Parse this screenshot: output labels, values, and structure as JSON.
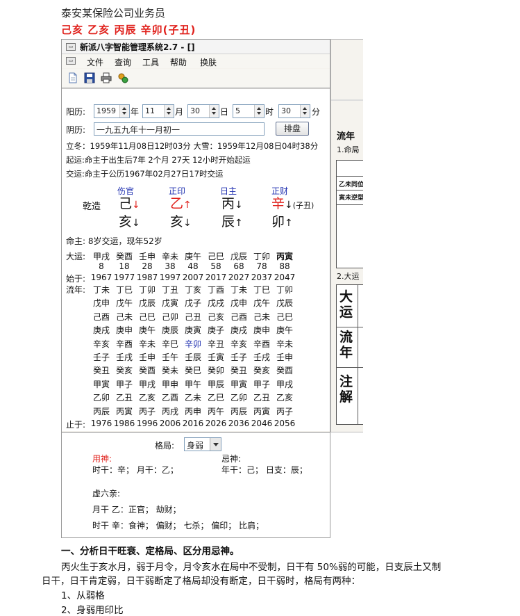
{
  "doc": {
    "title": "泰安某保险公司业务员",
    "bazi": "己亥 乙亥 丙辰 辛卯(子丑)"
  },
  "window": {
    "title": "新派八字智能管理系统2.7 - []",
    "menu": [
      "文件",
      "查询",
      "工具",
      "帮助",
      "换肤"
    ],
    "toolbar_icons": [
      "new-doc-icon",
      "save-icon",
      "print-icon",
      "settings-icon"
    ]
  },
  "form": {
    "solar_label": "阳历:",
    "year": "1959",
    "year_unit": "年",
    "month": "11",
    "month_unit": "月",
    "day": "30",
    "day_unit": "日",
    "hour": "5",
    "hour_unit": "时",
    "minute": "30",
    "minute_unit": "分",
    "lunar_label": "阴历:",
    "lunar_value": "一九五九年十一月初一",
    "arrange_button": "排盘",
    "jieqi": "立冬：1959年11月08日12时03分 大雪：1959年12月08日04时38分",
    "qiyun": "起运:命主于出生后7年 2个月 27天 12小时开始起运",
    "jiaoyun": "交运:命主于公历1967年02月27日17时交运"
  },
  "chart": {
    "qianzao": "乾造",
    "gods": [
      "伤官",
      "正印",
      "日主",
      "正财"
    ],
    "stems": [
      "己",
      "乙",
      "丙",
      "辛"
    ],
    "stem_arrows": [
      "↓",
      "↑",
      "↓",
      "↓"
    ],
    "branches": [
      "亥",
      "亥",
      "辰",
      "卯"
    ],
    "branch_arrows": [
      "↓",
      "↓",
      "↑",
      "↑"
    ],
    "kongwang": "(子丑)"
  },
  "dayun": {
    "mingzhu": "命主: 8岁交运，现年52岁",
    "label": "大运:",
    "pillars": [
      "甲戌",
      "癸酉",
      "壬申",
      "辛未",
      "庚午",
      "己巳",
      "戊辰",
      "丁卯",
      "丙寅"
    ],
    "ages": [
      "8",
      "18",
      "28",
      "38",
      "48",
      "58",
      "68",
      "78",
      "88"
    ],
    "start_label": "始于:",
    "start_years": [
      "1967",
      "1977",
      "1987",
      "1997",
      "2007",
      "2017",
      "2027",
      "2037",
      "2047"
    ],
    "liunian_label": "流年:",
    "liunian_rows": [
      [
        "丁未",
        "丁巳",
        "丁卯",
        "丁丑",
        "丁亥",
        "丁酉",
        "丁未",
        "丁巳",
        "丁卯"
      ],
      [
        "戊申",
        "戊午",
        "戊辰",
        "戊寅",
        "戊子",
        "戊戌",
        "戊申",
        "戊午",
        "戊辰"
      ],
      [
        "己酉",
        "己未",
        "己巳",
        "己卯",
        "己丑",
        "己亥",
        "己酉",
        "己未",
        "己巳"
      ],
      [
        "庚戌",
        "庚申",
        "庚午",
        "庚辰",
        "庚寅",
        "庚子",
        "庚戌",
        "庚申",
        "庚午"
      ],
      [
        "辛亥",
        "辛酉",
        "辛未",
        "辛巳",
        "辛卯",
        "辛丑",
        "辛亥",
        "辛酉",
        "辛未"
      ],
      [
        "壬子",
        "壬戌",
        "壬申",
        "壬午",
        "壬辰",
        "壬寅",
        "壬子",
        "壬戌",
        "壬申"
      ],
      [
        "癸丑",
        "癸亥",
        "癸酉",
        "癸未",
        "癸巳",
        "癸卯",
        "癸丑",
        "癸亥",
        "癸酉"
      ],
      [
        "甲寅",
        "甲子",
        "甲戌",
        "甲申",
        "甲午",
        "甲辰",
        "甲寅",
        "甲子",
        "甲戌"
      ],
      [
        "乙卯",
        "乙丑",
        "乙亥",
        "乙酉",
        "乙未",
        "乙巳",
        "乙卯",
        "乙丑",
        "乙亥"
      ],
      [
        "丙辰",
        "丙寅",
        "丙子",
        "丙戌",
        "丙申",
        "丙午",
        "丙辰",
        "丙寅",
        "丙子"
      ]
    ],
    "end_label": "止于:",
    "end_years": [
      "1976",
      "1986",
      "1996",
      "2006",
      "2016",
      "2026",
      "2036",
      "2046",
      "2056"
    ]
  },
  "bottom": {
    "geju_label": "格局:",
    "geju_value": "身弱",
    "yongshen_label": "用神:",
    "yongshen_values": "时干：辛；  月干：乙；",
    "jishen_label": "忌神:",
    "jishen_values": "年干：己；  日支：辰；",
    "xuliuqin": "虚六亲:",
    "line1": "月干 乙：正官；  劫财；",
    "line2": "时干 辛：食神；  偏财；  七杀；  偏印；  比肩；"
  },
  "right_panel": {
    "liunian": "流年",
    "mingju": "1.命局",
    "r1": "乙未同位",
    "r2": "寅未逆型",
    "dayun2": "2.大运",
    "big1": [
      "大",
      "运"
    ],
    "big2": [
      "流",
      "年"
    ],
    "big3": [
      "注",
      "解"
    ]
  },
  "article": {
    "heading": "一、分析日干旺衰、定格局、区分用忌神。",
    "para1": "丙火生于亥水月，弱于月令，月令亥水在局中不受制，日干有 50%弱的可能，日支辰土又制",
    "para2": "日干，日干肯定弱，日干弱断定了格局却没有断定，日干弱时，格局有两种：",
    "item1": "1、从弱格",
    "item2": "2、身弱用印比"
  }
}
